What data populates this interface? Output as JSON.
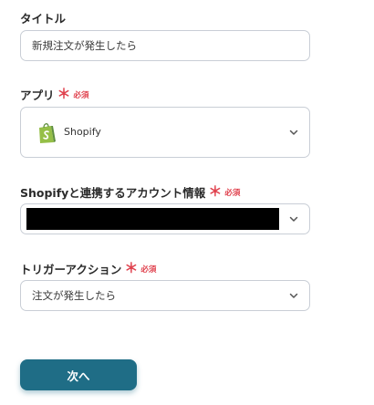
{
  "title_field": {
    "label": "タイトル",
    "value": "新規注文が発生したら"
  },
  "app_field": {
    "label": "アプリ",
    "required_mark": "＊",
    "required_text": "必須",
    "selected_app": "Shopify",
    "app_icon": "shopify-bag-icon",
    "dropdown_icon": "chevron-down-icon"
  },
  "account_field": {
    "label": "Shopifyと連携するアカウント情報",
    "required_mark": "＊",
    "required_text": "必須",
    "dropdown_icon": "chevron-down-icon"
  },
  "trigger_field": {
    "label": "トリガーアクション",
    "required_mark": "＊",
    "required_text": "必須",
    "value": "注文が発生したら",
    "dropdown_icon": "chevron-down-icon"
  },
  "next_button": {
    "label": "次へ"
  },
  "colors": {
    "required": "#e0424e",
    "button": "#1f6d86",
    "border": "#c9ced6",
    "shopify_green": "#95bf47"
  }
}
